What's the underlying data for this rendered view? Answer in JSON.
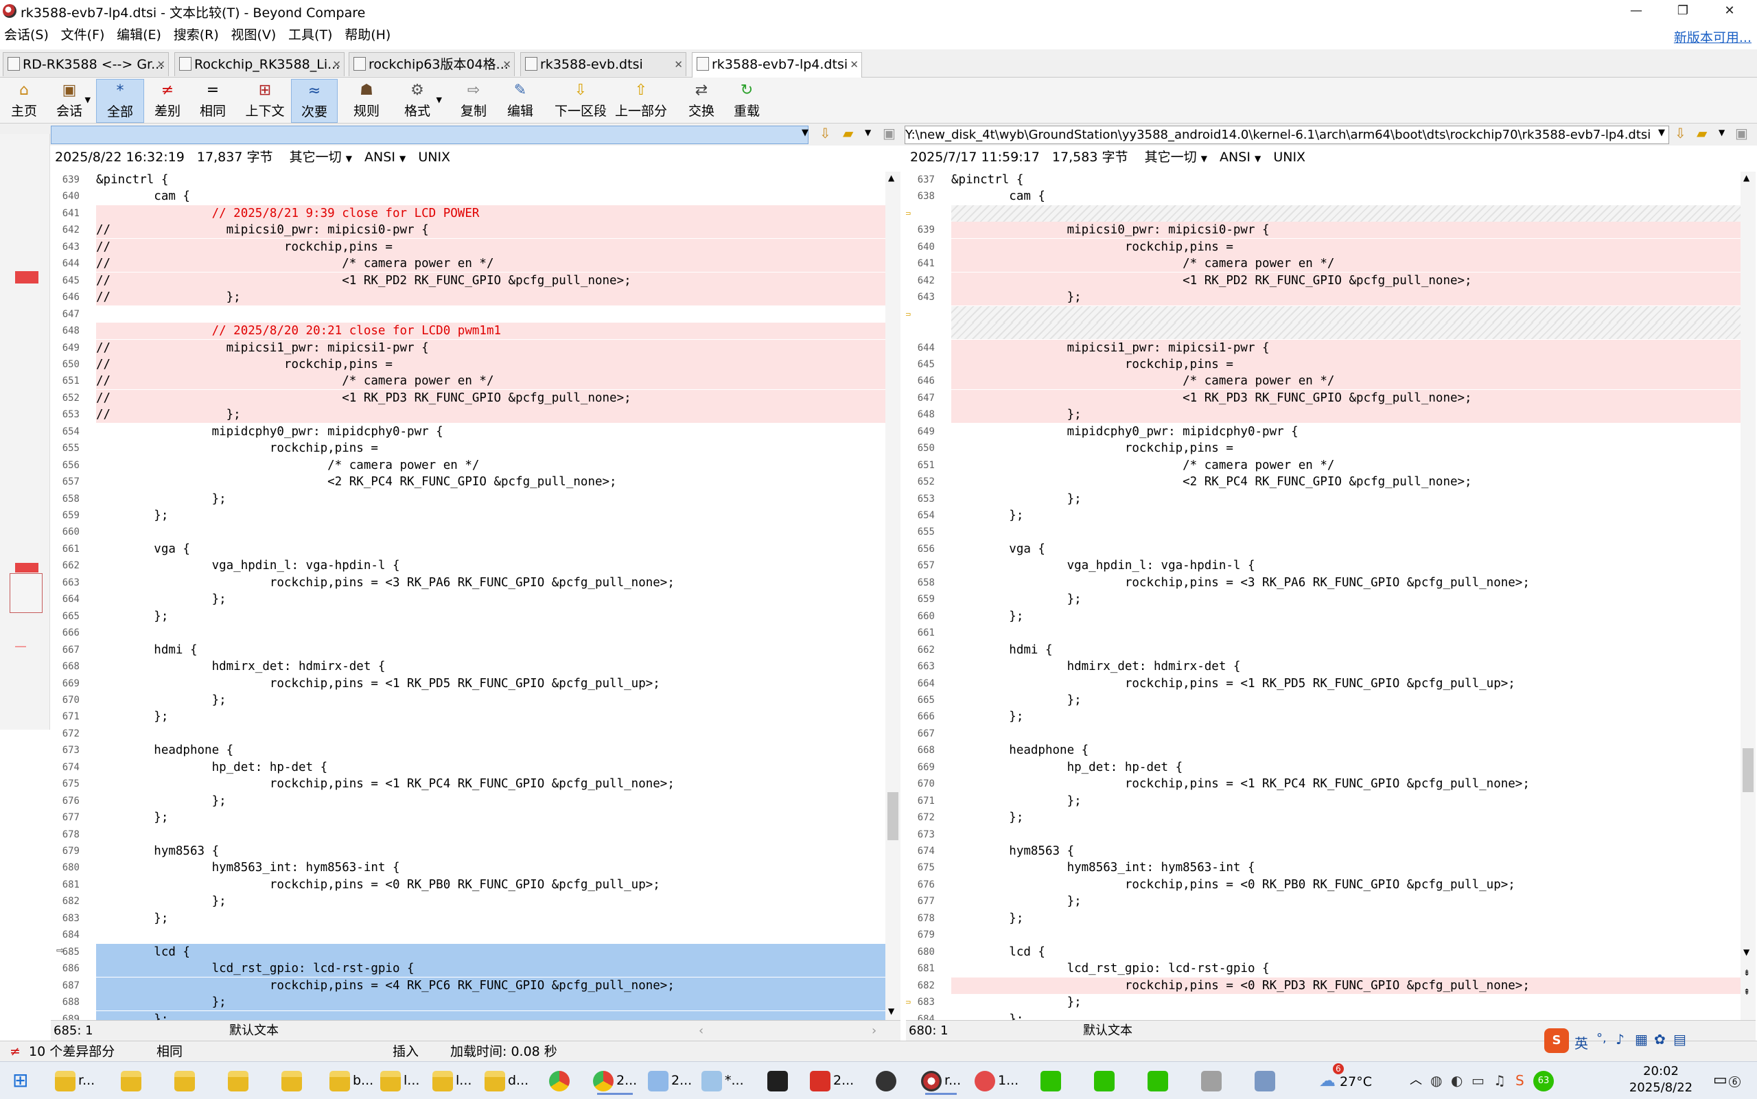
{
  "window": {
    "title": "rk3588-evb7-lp4.dtsi - 文本比较(T) - Beyond Compare",
    "minimize": "—",
    "maximize": "❐",
    "close": "✕"
  },
  "menu": [
    "会话(S)",
    "文件(F)",
    "编辑(E)",
    "搜索(R)",
    "视图(V)",
    "工具(T)",
    "帮助(H)"
  ],
  "new_version_link": "新版本可用...",
  "tabs": [
    {
      "label": "RD-RK3588 <--> Gr..."
    },
    {
      "label": "Rockchip_RK3588_Li..."
    },
    {
      "label": "rockchip63版本04格..."
    },
    {
      "label": "rk3588-evb.dtsi"
    },
    {
      "label": "rk3588-evb7-lp4.dtsi"
    }
  ],
  "toolbar": [
    {
      "label": "主页",
      "icon": "home-icon",
      "glyph": "⌂"
    },
    {
      "label": "会话",
      "icon": "session-icon",
      "glyph": "▣"
    },
    {
      "label": "全部",
      "icon": "all-icon",
      "glyph": "*"
    },
    {
      "label": "差别",
      "icon": "diff-icon",
      "glyph": "≠"
    },
    {
      "label": "相同",
      "icon": "same-icon",
      "glyph": "="
    },
    {
      "label": "上下文",
      "icon": "context-icon",
      "glyph": "⊞"
    },
    {
      "label": "次要",
      "icon": "minor-icon",
      "glyph": "≈"
    },
    {
      "label": "规则",
      "icon": "rules-icon",
      "glyph": "☗"
    },
    {
      "label": "格式",
      "icon": "format-icon",
      "glyph": "⚙"
    },
    {
      "label": "复制",
      "icon": "copy-icon",
      "glyph": "⇨"
    },
    {
      "label": "编辑",
      "icon": "edit-icon",
      "glyph": "✎"
    },
    {
      "label": "下一区段",
      "icon": "next-section-icon",
      "glyph": "⇩"
    },
    {
      "label": "上一部分",
      "icon": "prev-section-icon",
      "glyph": "⇧"
    },
    {
      "label": "交换",
      "icon": "swap-icon",
      "glyph": "⇄"
    },
    {
      "label": "重载",
      "icon": "reload-icon",
      "glyph": "↻"
    }
  ],
  "left": {
    "path": "",
    "date": "2025/8/22 16:32:19",
    "size": "17,837 字节",
    "filter": "其它一切",
    "encoding": "ANSI",
    "eol": "UNIX",
    "position": "685: 1",
    "style": "默认文本"
  },
  "right": {
    "path": "Y:\\new_disk_4t\\wyb\\GroundStation\\yy3588_android14.0\\kernel-6.1\\arch\\arm64\\boot\\dts\\rockchip70\\rk3588-evb7-lp4.dtsi",
    "date": "2025/7/17 11:59:17",
    "size": "17,583 字节",
    "filter": "其它一切",
    "encoding": "ANSI",
    "eol": "UNIX",
    "position": "680: 1",
    "style": "默认文本"
  },
  "left_lines": [
    {
      "n": "639",
      "t": "&pinctrl {",
      "k": ""
    },
    {
      "n": "640",
      "t": "\tcam {",
      "k": ""
    },
    {
      "n": "641",
      "t": "\t\t// 2025/8/21 9:39 close for LCD POWER",
      "k": "dc"
    },
    {
      "n": "642",
      "t": "//\t\tmipicsi0_pwr: mipicsi0-pwr {",
      "k": "d"
    },
    {
      "n": "643",
      "t": "//\t\t\trockchip,pins =",
      "k": "d"
    },
    {
      "n": "644",
      "t": "//\t\t\t\t/* camera power en */",
      "k": "d"
    },
    {
      "n": "645",
      "t": "//\t\t\t\t<1 RK_PD2 RK_FUNC_GPIO &pcfg_pull_none>;",
      "k": "d"
    },
    {
      "n": "646",
      "t": "//\t\t};",
      "k": "d"
    },
    {
      "n": "647",
      "t": "",
      "k": ""
    },
    {
      "n": "648",
      "t": "\t\t// 2025/8/20 20:21 close for LCD0 pwm1m1",
      "k": "dc"
    },
    {
      "n": "649",
      "t": "//\t\tmipicsi1_pwr: mipicsi1-pwr {",
      "k": "d"
    },
    {
      "n": "650",
      "t": "//\t\t\trockchip,pins =",
      "k": "d"
    },
    {
      "n": "651",
      "t": "//\t\t\t\t/* camera power en */",
      "k": "d"
    },
    {
      "n": "652",
      "t": "//\t\t\t\t<1 RK_PD3 RK_FUNC_GPIO &pcfg_pull_none>;",
      "k": "d"
    },
    {
      "n": "653",
      "t": "//\t\t};",
      "k": "d"
    },
    {
      "n": "654",
      "t": "\t\tmipidcphy0_pwr: mipidcphy0-pwr {",
      "k": ""
    },
    {
      "n": "655",
      "t": "\t\t\trockchip,pins =",
      "k": ""
    },
    {
      "n": "656",
      "t": "\t\t\t\t/* camera power en */",
      "k": ""
    },
    {
      "n": "657",
      "t": "\t\t\t\t<2 RK_PC4 RK_FUNC_GPIO &pcfg_pull_none>;",
      "k": ""
    },
    {
      "n": "658",
      "t": "\t\t};",
      "k": ""
    },
    {
      "n": "659",
      "t": "\t};",
      "k": ""
    },
    {
      "n": "660",
      "t": "",
      "k": ""
    },
    {
      "n": "661",
      "t": "\tvga {",
      "k": ""
    },
    {
      "n": "662",
      "t": "\t\tvga_hpdin_l: vga-hpdin-l {",
      "k": ""
    },
    {
      "n": "663",
      "t": "\t\t\trockchip,pins = <3 RK_PA6 RK_FUNC_GPIO &pcfg_pull_none>;",
      "k": ""
    },
    {
      "n": "664",
      "t": "\t\t};",
      "k": ""
    },
    {
      "n": "665",
      "t": "\t};",
      "k": ""
    },
    {
      "n": "666",
      "t": "",
      "k": ""
    },
    {
      "n": "667",
      "t": "\thdmi {",
      "k": ""
    },
    {
      "n": "668",
      "t": "\t\thdmirx_det: hdmirx-det {",
      "k": ""
    },
    {
      "n": "669",
      "t": "\t\t\trockchip,pins = <1 RK_PD5 RK_FUNC_GPIO &pcfg_pull_up>;",
      "k": ""
    },
    {
      "n": "670",
      "t": "\t\t};",
      "k": ""
    },
    {
      "n": "671",
      "t": "\t};",
      "k": ""
    },
    {
      "n": "672",
      "t": "",
      "k": ""
    },
    {
      "n": "673",
      "t": "\theadphone {",
      "k": ""
    },
    {
      "n": "674",
      "t": "\t\thp_det: hp-det {",
      "k": ""
    },
    {
      "n": "675",
      "t": "\t\t\trockchip,pins = <1 RK_PC4 RK_FUNC_GPIO &pcfg_pull_none>;",
      "k": ""
    },
    {
      "n": "676",
      "t": "\t\t};",
      "k": ""
    },
    {
      "n": "677",
      "t": "\t};",
      "k": ""
    },
    {
      "n": "678",
      "t": "",
      "k": ""
    },
    {
      "n": "679",
      "t": "\thym8563 {",
      "k": ""
    },
    {
      "n": "680",
      "t": "\t\thym8563_int: hym8563-int {",
      "k": ""
    },
    {
      "n": "681",
      "t": "\t\t\trockchip,pins = <0 RK_PB0 RK_FUNC_GPIO &pcfg_pull_up>;",
      "k": ""
    },
    {
      "n": "682",
      "t": "\t\t};",
      "k": ""
    },
    {
      "n": "683",
      "t": "\t};",
      "k": ""
    },
    {
      "n": "684",
      "t": "",
      "k": ""
    },
    {
      "n": "685",
      "t": "\tlcd {",
      "k": "s"
    },
    {
      "n": "686",
      "t": "\t\tlcd_rst_gpio: lcd-rst-gpio {",
      "k": "s"
    },
    {
      "n": "687",
      "t": "\t\t\trockchip,pins = <4 RK_PC6 RK_FUNC_GPIO &pcfg_pull_none>;",
      "k": "s"
    },
    {
      "n": "688",
      "t": "\t\t};",
      "k": "s"
    },
    {
      "n": "689",
      "t": "\t};",
      "k": "s"
    }
  ],
  "right_lines": [
    {
      "n": "637",
      "t": "&pinctrl {",
      "k": ""
    },
    {
      "n": "638",
      "t": "\tcam {",
      "k": ""
    },
    {
      "n": "",
      "t": "",
      "k": "h"
    },
    {
      "n": "639",
      "t": "\t\tmipicsi0_pwr: mipicsi0-pwr {",
      "k": "d"
    },
    {
      "n": "640",
      "t": "\t\t\trockchip,pins =",
      "k": "d"
    },
    {
      "n": "641",
      "t": "\t\t\t\t/* camera power en */",
      "k": "d"
    },
    {
      "n": "642",
      "t": "\t\t\t\t<1 RK_PD2 RK_FUNC_GPIO &pcfg_pull_none>;",
      "k": "d"
    },
    {
      "n": "643",
      "t": "\t\t};",
      "k": "d"
    },
    {
      "n": "",
      "t": "",
      "k": "h"
    },
    {
      "n": "",
      "t": "",
      "k": "h"
    },
    {
      "n": "644",
      "t": "\t\tmipicsi1_pwr: mipicsi1-pwr {",
      "k": "d"
    },
    {
      "n": "645",
      "t": "\t\t\trockchip,pins =",
      "k": "d"
    },
    {
      "n": "646",
      "t": "\t\t\t\t/* camera power en */",
      "k": "d"
    },
    {
      "n": "647",
      "t": "\t\t\t\t<1 RK_PD3 RK_FUNC_GPIO &pcfg_pull_none>;",
      "k": "d"
    },
    {
      "n": "648",
      "t": "\t\t};",
      "k": "d"
    },
    {
      "n": "649",
      "t": "\t\tmipidcphy0_pwr: mipidcphy0-pwr {",
      "k": ""
    },
    {
      "n": "650",
      "t": "\t\t\trockchip,pins =",
      "k": ""
    },
    {
      "n": "651",
      "t": "\t\t\t\t/* camera power en */",
      "k": ""
    },
    {
      "n": "652",
      "t": "\t\t\t\t<2 RK_PC4 RK_FUNC_GPIO &pcfg_pull_none>;",
      "k": ""
    },
    {
      "n": "653",
      "t": "\t\t};",
      "k": ""
    },
    {
      "n": "654",
      "t": "\t};",
      "k": ""
    },
    {
      "n": "655",
      "t": "",
      "k": ""
    },
    {
      "n": "656",
      "t": "\tvga {",
      "k": ""
    },
    {
      "n": "657",
      "t": "\t\tvga_hpdin_l: vga-hpdin-l {",
      "k": ""
    },
    {
      "n": "658",
      "t": "\t\t\trockchip,pins = <3 RK_PA6 RK_FUNC_GPIO &pcfg_pull_none>;",
      "k": ""
    },
    {
      "n": "659",
      "t": "\t\t};",
      "k": ""
    },
    {
      "n": "660",
      "t": "\t};",
      "k": ""
    },
    {
      "n": "661",
      "t": "",
      "k": ""
    },
    {
      "n": "662",
      "t": "\thdmi {",
      "k": ""
    },
    {
      "n": "663",
      "t": "\t\thdmirx_det: hdmirx-det {",
      "k": ""
    },
    {
      "n": "664",
      "t": "\t\t\trockchip,pins = <1 RK_PD5 RK_FUNC_GPIO &pcfg_pull_up>;",
      "k": ""
    },
    {
      "n": "665",
      "t": "\t\t};",
      "k": ""
    },
    {
      "n": "666",
      "t": "\t};",
      "k": ""
    },
    {
      "n": "667",
      "t": "",
      "k": ""
    },
    {
      "n": "668",
      "t": "\theadphone {",
      "k": ""
    },
    {
      "n": "669",
      "t": "\t\thp_det: hp-det {",
      "k": ""
    },
    {
      "n": "670",
      "t": "\t\t\trockchip,pins = <1 RK_PC4 RK_FUNC_GPIO &pcfg_pull_none>;",
      "k": ""
    },
    {
      "n": "671",
      "t": "\t\t};",
      "k": ""
    },
    {
      "n": "672",
      "t": "\t};",
      "k": ""
    },
    {
      "n": "673",
      "t": "",
      "k": ""
    },
    {
      "n": "674",
      "t": "\thym8563 {",
      "k": ""
    },
    {
      "n": "675",
      "t": "\t\thym8563_int: hym8563-int {",
      "k": ""
    },
    {
      "n": "676",
      "t": "\t\t\trockchip,pins = <0 RK_PB0 RK_FUNC_GPIO &pcfg_pull_up>;",
      "k": ""
    },
    {
      "n": "677",
      "t": "\t\t};",
      "k": ""
    },
    {
      "n": "678",
      "t": "\t};",
      "k": ""
    },
    {
      "n": "679",
      "t": "",
      "k": ""
    },
    {
      "n": "680",
      "t": "\tlcd {",
      "k": ""
    },
    {
      "n": "681",
      "t": "\t\tlcd_rst_gpio: lcd-rst-gpio {",
      "k": ""
    },
    {
      "n": "682",
      "t": "\t\t\trockchip,pins = <0 RK_PD3 RK_FUNC_GPIO &pcfg_pull_none>;",
      "k": "d"
    },
    {
      "n": "683",
      "t": "\t\t};",
      "k": ""
    },
    {
      "n": "684",
      "t": "\t};",
      "k": ""
    }
  ],
  "status": {
    "diff_count": "10 个差异部分",
    "same": "相同",
    "mode": "插入",
    "load_time": "加载时间: 0.08 秒"
  },
  "taskbar": {
    "items": [
      "r...",
      "b...",
      "l...",
      "l...",
      "d...",
      "2...",
      "2...",
      "*...",
      "2...",
      "r...",
      "1..."
    ],
    "weather": "27°C",
    "weather_badge": "6",
    "time": "20:02",
    "date": "2025/8/22",
    "ime_lang": "英",
    "notif_count": "6",
    "badge_63": "63"
  },
  "colors": {
    "diff_bg": "#fde3e3",
    "diff_text": "#e00000",
    "selected_bg": "#a8cbf0",
    "accent": "#1a5fc4"
  }
}
